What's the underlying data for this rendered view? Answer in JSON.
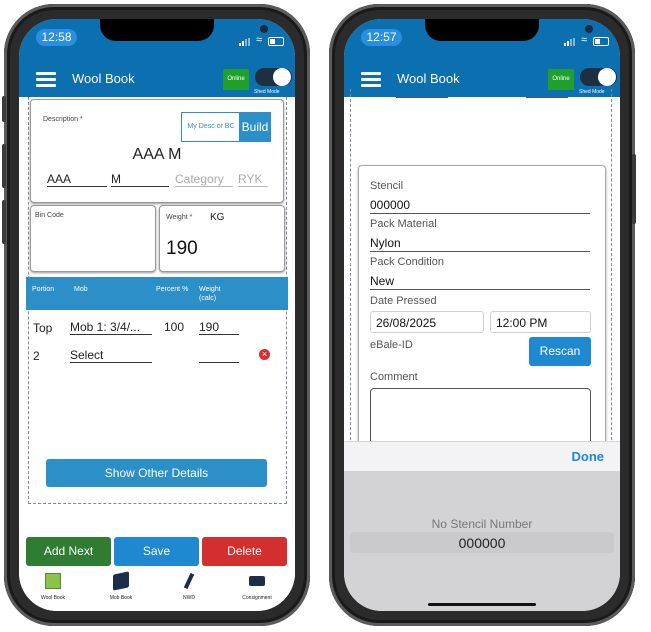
{
  "status": {
    "left_time": "12:58",
    "right_time": "12:57"
  },
  "appbar": {
    "title": "Wool Book",
    "online": "Online",
    "shed_mode": "Shed Mode"
  },
  "form": {
    "description_label": "Description *",
    "desc_input_placeholder": "My Desc or BC",
    "build_label": "Build",
    "description_value": "AAA M",
    "grade": "AAA",
    "mob": "M",
    "category_placeholder": "Category",
    "ryk_placeholder": "RYK",
    "bin_code_label": "Bin Code",
    "weight_label": "Weight *",
    "weight_unit": "KG",
    "weight_value": "190"
  },
  "table": {
    "headers": {
      "portion": "Portion",
      "mob": "Mob",
      "percent": "Percent %",
      "weight": "Weight (calc)"
    },
    "rows": [
      {
        "portion": "Top",
        "mob": "Mob 1: 3/4/...",
        "percent": "100",
        "weight": "190"
      },
      {
        "portion": "2",
        "mob": "Select",
        "percent": "",
        "weight": ""
      }
    ]
  },
  "buttons": {
    "show_other_details": "Show Other Details",
    "add_next": "Add Next",
    "save": "Save",
    "delete": "Delete"
  },
  "tabs": [
    {
      "label": "Wool Book"
    },
    {
      "label": "Mob Book"
    },
    {
      "label": "NWD"
    },
    {
      "label": "Consignment"
    }
  ],
  "right": {
    "stencil_label": "Stencil",
    "stencil_value": "000000",
    "pack_material_label": "Pack Material",
    "pack_material_value": "Nylon",
    "pack_condition_label": "Pack Condition",
    "pack_condition_value": "New",
    "date_pressed_label": "Date Pressed",
    "date_value": "26/08/2025",
    "time_value": "12:00 PM",
    "ebale_label": "eBale-ID",
    "rescan_label": "Rescan",
    "comment_label": "Comment",
    "done_label": "Done",
    "picker_option_1": "No Stencil Number",
    "picker_option_2": "000000"
  },
  "colors": {
    "primary": "#0b6fb0",
    "table_header": "#2d8fc8",
    "add_next": "#2e7d32",
    "save": "#1e88d0",
    "delete": "#d32f2f",
    "online": "#1fa02c"
  }
}
